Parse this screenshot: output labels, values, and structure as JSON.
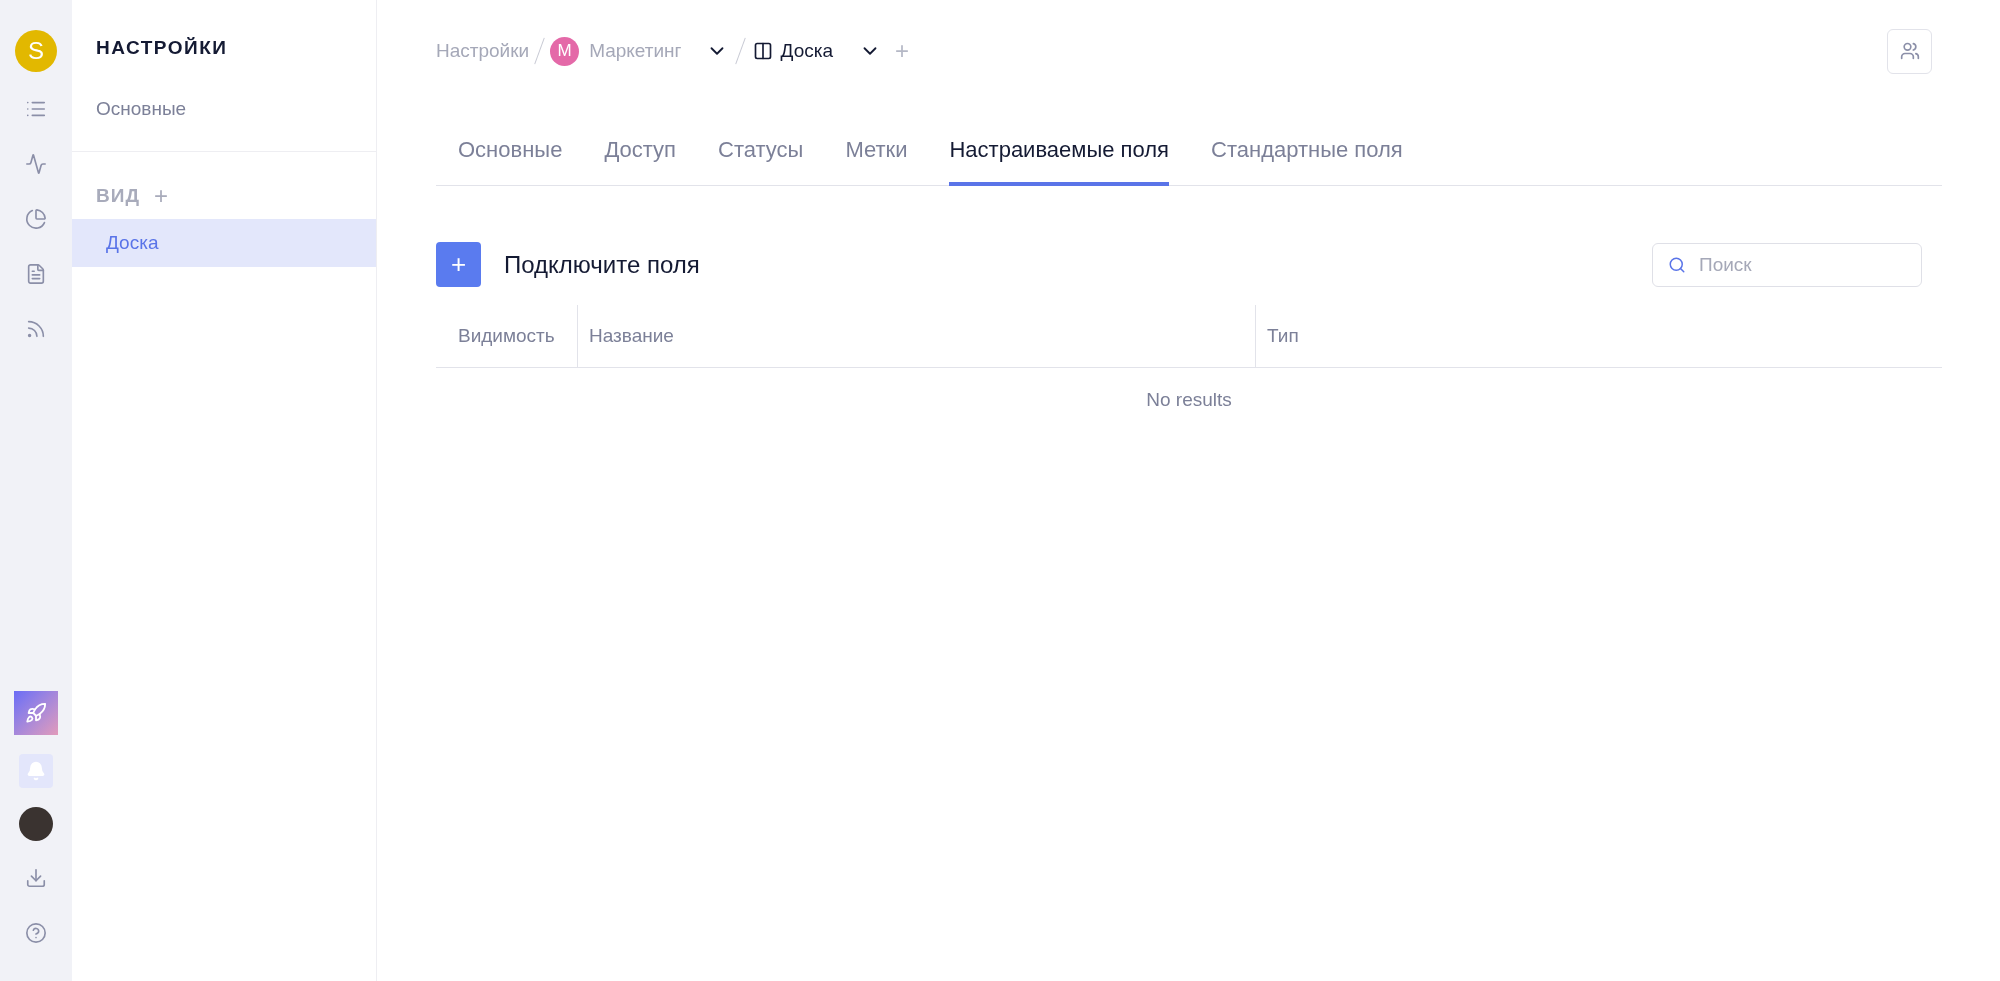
{
  "rail": {
    "avatar_letter": "S"
  },
  "sidebar": {
    "title": "НАСТРОЙКИ",
    "items": [
      {
        "label": "Основные",
        "selected": false
      }
    ],
    "section": {
      "title": "ВИД",
      "plus": "+",
      "items": [
        {
          "label": "Доска",
          "selected": true
        }
      ]
    }
  },
  "breadcrumb": {
    "root": "Настройки",
    "project_letter": "M",
    "project": "Маркетинг",
    "view": "Доска",
    "plus": "+"
  },
  "tabs": [
    {
      "label": "Основные",
      "selected": false
    },
    {
      "label": "Доступ",
      "selected": false
    },
    {
      "label": "Статусы",
      "selected": false
    },
    {
      "label": "Метки",
      "selected": false
    },
    {
      "label": "Настраиваемые поля",
      "selected": true
    },
    {
      "label": "Стандартные поля",
      "selected": false
    }
  ],
  "toolbar": {
    "add": "+",
    "title": "Подключите поля",
    "search": {
      "placeholder": "Поиск"
    }
  },
  "table": {
    "columns": [
      "Видимость",
      "Название",
      "Тип"
    ],
    "empty": "No results"
  }
}
